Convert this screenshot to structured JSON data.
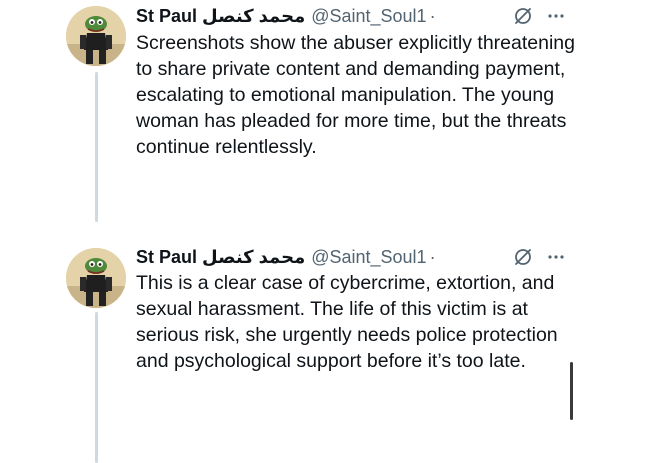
{
  "tweets": [
    {
      "display_name": "St Paul محمد كنصل",
      "handle": "@Saint_Soul1",
      "separator": "·",
      "avatar": "avatar-pepe-figure",
      "icons": {
        "interaction": "no-sign-icon",
        "more": "more-icon"
      },
      "more_label": "···",
      "text": "Screenshots show the abuser explicitly threatening to share private content and demanding payment, escalating to emotional manipulation. The young woman has pleaded for more time, but the threats continue relentlessly."
    },
    {
      "display_name": "St Paul محمد كنصل",
      "handle": "@Saint_Soul1",
      "separator": "·",
      "avatar": "avatar-pepe-figure",
      "icons": {
        "interaction": "no-sign-icon",
        "more": "more-icon"
      },
      "more_label": "···",
      "text": "This is a clear case of cybercrime, extortion, and sexual harassment. The life of this victim is at serious risk, she urgently needs police protection and psychological support before it’s too late."
    }
  ],
  "colors": {
    "text": "#0f1419",
    "secondary": "#536471",
    "thread_line": "#cfd9de",
    "background": "#ffffff"
  }
}
